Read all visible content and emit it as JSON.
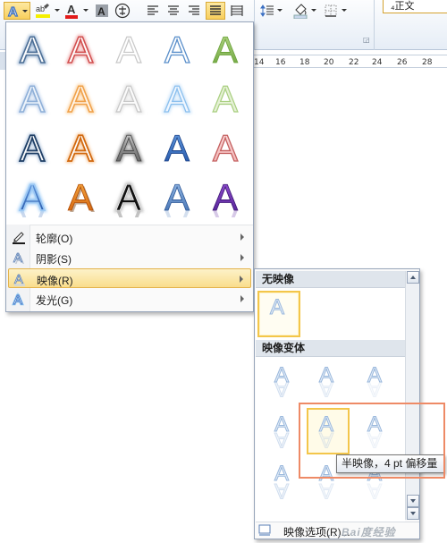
{
  "ribbon": {
    "style_box_label": "₄正文",
    "ruler_ticks": [
      "14",
      "16",
      "18",
      "20",
      "22",
      "24",
      "26",
      "28"
    ],
    "accent_color": "#f8cf5d"
  },
  "effects_menu": {
    "gallery_columns": 5,
    "gallery_rows": 4,
    "sample_glyph": "A",
    "items": [
      {
        "label": "轮廓(O)",
        "icon": "outline-pencil-icon",
        "has_submenu": true
      },
      {
        "label": "阴影(S)",
        "icon": "shadow-a-icon",
        "has_submenu": true
      },
      {
        "label": "映像(R)",
        "icon": "reflection-a-icon",
        "has_submenu": true,
        "highlighted": true
      },
      {
        "label": "发光(G)",
        "icon": "glow-a-icon",
        "has_submenu": true
      }
    ]
  },
  "reflection_menu": {
    "section_none": "无映像",
    "section_variants": "映像变体",
    "options_label": "映像选项(R)...",
    "selected": "no-reflection",
    "hovered_variant": {
      "row": 2,
      "col": 2
    }
  },
  "tooltip": {
    "text": "半映像，4 pt 偏移量"
  },
  "watermark": {
    "text": "Bai度经验"
  },
  "colors": {
    "highlight_fill": "#f9dd8c",
    "highlight_border": "#e3b34d",
    "callout_border": "#ee8a66",
    "menu_border": "#97a5ba"
  }
}
